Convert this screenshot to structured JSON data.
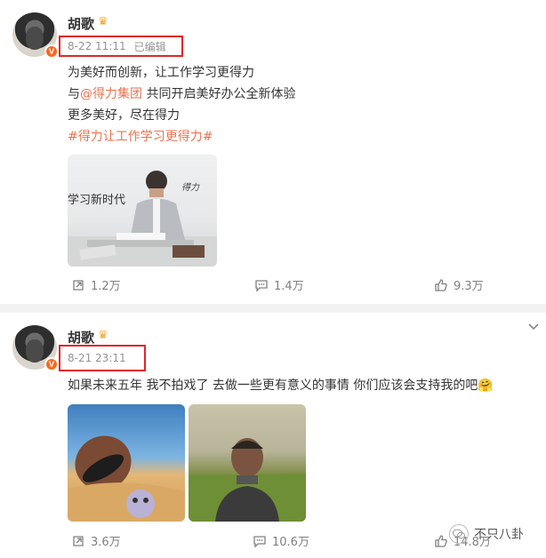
{
  "posts": [
    {
      "author": "胡歌",
      "verified_badge": "V",
      "time": "8-22 11:11",
      "edited_label": "已编辑",
      "text_lines": [
        {
          "before": "为美好而创新，让工作学习更得力",
          "mention": "",
          "after": ""
        },
        {
          "before": "与",
          "mention": "@得力集团",
          "after": " 共同开启美好办公全新体验"
        },
        {
          "before": "更多美好，尽在得力",
          "mention": "",
          "after": ""
        }
      ],
      "hashtag": "#得力让工作学习更得力#",
      "image": {
        "headline": "学习新时代",
        "signature": "得力"
      },
      "actions": {
        "repost": "1.2万",
        "comment": "1.4万",
        "like": "9.3万"
      }
    },
    {
      "author": "胡歌",
      "verified_badge": "V",
      "time": "8-21 23:11",
      "text": "如果未来五年 我不拍戏了 去做一些更有意义的事情 你们应该会支持我的吧",
      "emoji": "🤗",
      "actions": {
        "repost": "3.6万",
        "comment": "10.6万",
        "like": "14.8万"
      }
    }
  ],
  "watermark": "不只八卦",
  "colors": {
    "accent": "#eb7350",
    "highlight_box": "#e0262b",
    "meta_gray": "#939393",
    "badge_orange": "#f36b21"
  },
  "icons": [
    "crown-icon",
    "repost-icon",
    "comment-icon",
    "like-icon",
    "chevron-down-icon",
    "wechat-watermark-icon"
  ]
}
